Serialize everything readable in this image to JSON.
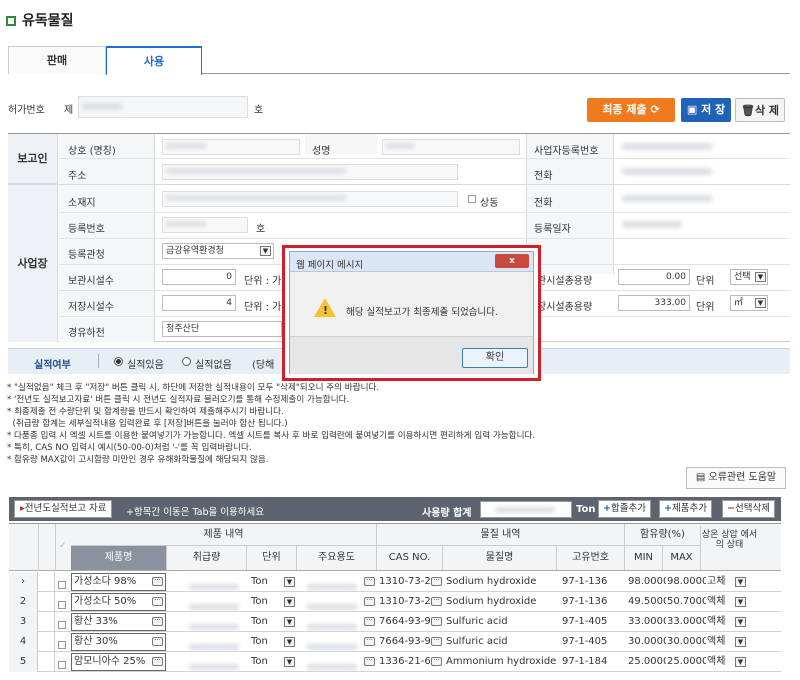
{
  "page": {
    "title": "유독물질"
  },
  "tabs": [
    {
      "label": "판매"
    },
    {
      "label": "사용"
    }
  ],
  "permit": {
    "label": "허가번호",
    "prefix": "제",
    "suffix": "호"
  },
  "actions": {
    "final_submit": "최종 제출",
    "save": "저 장",
    "delete": "삭 제"
  },
  "reporter": {
    "section": "보고인",
    "name_label": "상호 (명칭)",
    "person_label": "성명",
    "biz_no_label": "사업자등록번호",
    "address_label": "주소",
    "phone_label": "전화"
  },
  "site": {
    "section": "사업장",
    "location_label": "소재지",
    "same_label": "상동",
    "phone_label": "전화",
    "reg_no_label": "등록번호",
    "reg_suffix": "호",
    "reg_date_label": "등록일자",
    "authority_label": "등록관청",
    "authority_value": "금강유역환경청",
    "storage_count_label": "보관시설수",
    "storage_count_value": "0",
    "unit_label": "단위",
    "unit_prefix": "가",
    "storage_total_label": "관시설총용량",
    "storage_total_value": "0.00",
    "storage_unit_value": "선택",
    "store_count_label": "저장시설수",
    "store_count_value": "4",
    "store_total_label": "장시설총용량",
    "store_total_value": "333.00",
    "store_unit_value": "㎥",
    "via_label": "경유하천",
    "via_value": "청주산단"
  },
  "performance": {
    "label": "실적여부",
    "opt_yes": "실적있음",
    "opt_no": "실적없음",
    "tail": "(당해"
  },
  "notes": [
    "* \"실적없음\" 체크 후 \"저장\" 버튼 클릭 시, 하단에 저장한 실적내용이 모두 \"삭제\"되오니 주의 바랍니다.",
    "* '전년도 실적보고자료' 버튼 클릭 시 전년도 실적자료 불러오기를 통해 수정제출이 가능합니다.",
    "* 최종제출 전 수량단위 및 합계량을 반드시 확인하여 제출해주시기 바랍니다.",
    "  (취급량 합계는 세부실적내용 입력완료 후 [저장]버튼을 눌러야 합산 됩니다.)",
    "* 다품종 입력 시 엑셀 시트를 이용한 붙여넣기가 가능합니다. 엑셀 시트를 복사 후 바로 입력란에 붙여넣기를 이용하시면 편리하게 입력 가능합니다.",
    "* 특히, CAS NO 입력시 예시(50-00-0)처럼 '-'를 꼭 입력바랍니다.",
    "* 함유량 MAX값이 고시함량 미만인 경우 유해화학물질에 해당되지 않음."
  ],
  "help_button": "오류관련 도움말",
  "toolbar": {
    "prev_year": "전년도실적보고 자료",
    "tab_hint": "+항목간 이동은 Tab을 이용하세요",
    "usage_total_label": "사용량 합계",
    "usage_unit": "Ton",
    "add_total": "합졸추가",
    "add_product": "제품추가",
    "delete_selected": "선택삭제"
  },
  "grid": {
    "group_product": "제품 내역",
    "group_material": "물질 내역",
    "group_content": "함유량(%)",
    "col_product": "제품명",
    "col_qty": "취급량",
    "col_unit": "단위",
    "col_use": "주요용도",
    "col_cas": "CAS NO.",
    "col_material": "물질명",
    "col_id": "고유번호",
    "col_min": "MIN",
    "col_max": "MAX",
    "col_state": "상온 상압 에서의 상태",
    "rows": [
      {
        "no": "",
        "product": "가성소다 98%",
        "unit": "Ton",
        "cas": "1310-73-2",
        "material": "Sodium hydroxide",
        "id": "97-1-136",
        "min": "98.0000",
        "max": "98.0000",
        "state": "고체"
      },
      {
        "no": "2",
        "product": "가성소다 50%",
        "unit": "Ton",
        "cas": "1310-73-2",
        "material": "Sodium hydroxide",
        "id": "97-1-136",
        "min": "49.5000",
        "max": "50.7000",
        "state": "액체"
      },
      {
        "no": "3",
        "product": "황산 33%",
        "unit": "Ton",
        "cas": "7664-93-9",
        "material": "Sulfuric acid",
        "id": "97-1-405",
        "min": "33.0000",
        "max": "33.0000",
        "state": "액체"
      },
      {
        "no": "4",
        "product": "황산 30%",
        "unit": "Ton",
        "cas": "7664-93-9",
        "material": "Sulfuric acid",
        "id": "97-1-405",
        "min": "30.0000",
        "max": "30.0000",
        "state": "액체"
      },
      {
        "no": "5",
        "product": "암모니아수 25%",
        "unit": "Ton",
        "cas": "1336-21-6",
        "material": "Ammonium hydroxide",
        "id": "97-1-184",
        "min": "25.0000",
        "max": "25.0000",
        "state": "액체"
      }
    ]
  },
  "dialog": {
    "title": "웹 페이지 메시지",
    "message": "해당 실적보고가 최종제출 되었습니다.",
    "ok": "확인",
    "close": "x"
  }
}
